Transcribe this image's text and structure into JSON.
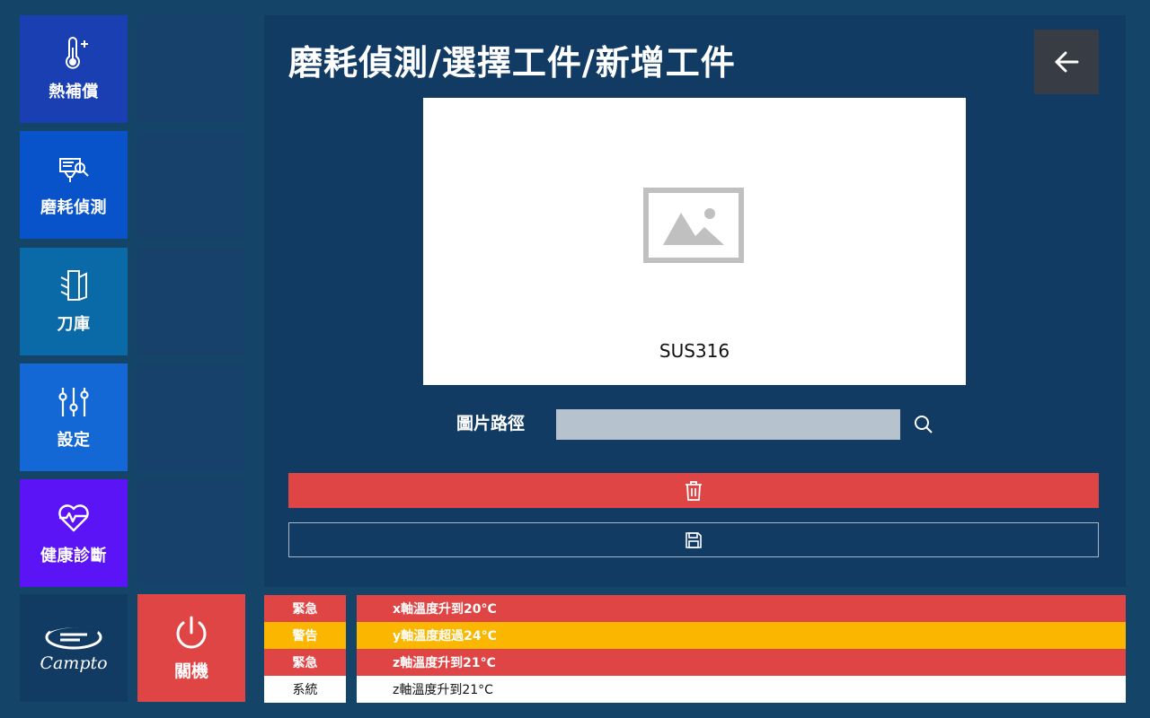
{
  "colors": {
    "background": "#154469",
    "panel": "#113b63",
    "danger": "#e04545",
    "warning": "#fbb700",
    "system": "#ffffff",
    "back_button": "#383c45"
  },
  "sidebar": {
    "items": [
      {
        "label": "熱補償",
        "icon": "thermometer-plus-icon",
        "color": "#1a3fb3"
      },
      {
        "label": "磨耗偵測",
        "icon": "tool-inspect-icon",
        "color": "#0853c9"
      },
      {
        "label": "刀庫",
        "icon": "tool-magazine-icon",
        "color": "#0a6aa8"
      },
      {
        "label": "設定",
        "icon": "sliders-icon",
        "color": "#1468d6"
      },
      {
        "label": "健康診斷",
        "icon": "heart-pulse-icon",
        "color": "#5b14f5"
      }
    ],
    "logo_text": "Campto",
    "power_label": "關機",
    "power_icon": "power-icon"
  },
  "main": {
    "title": "磨耗偵測/選擇工件/新增工件",
    "back_icon": "arrow-left-icon",
    "preview_caption": "SUS316",
    "preview_icon": "image-placeholder-icon",
    "path_label": "圖片路徑",
    "path_value": "",
    "search_icon": "search-icon",
    "delete_icon": "trash-icon",
    "save_icon": "floppy-icon"
  },
  "alarms": [
    {
      "level": "緊急",
      "message": "x軸溫度升到20°C",
      "color": "#e04545",
      "text_color": "#ffffff"
    },
    {
      "level": "警告",
      "message": "y軸溫度超過24°C",
      "color": "#fbb700",
      "text_color": "#ffffff"
    },
    {
      "level": "緊急",
      "message": "z軸溫度升到21°C",
      "color": "#e04545",
      "text_color": "#ffffff"
    },
    {
      "level": "系統",
      "message": "z軸溫度升到21°C",
      "color": "#ffffff",
      "text_color": "#111111"
    }
  ]
}
